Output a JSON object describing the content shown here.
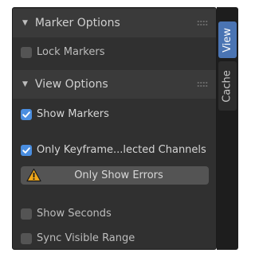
{
  "marker_options": {
    "title": "Marker Options",
    "lock_markers": "Lock Markers"
  },
  "view_options": {
    "title": "View Options",
    "show_markers": "Show Markers",
    "only_keyframes": "Only Keyframe...lected Channels",
    "only_show_errors": "Only Show Errors",
    "show_seconds": "Show Seconds",
    "sync_visible_range": "Sync Visible Range"
  },
  "tabs": {
    "view": "View",
    "cache": "Cache"
  },
  "colors": {
    "accent": "#4a8ee0",
    "tab_active": "#4a74b3",
    "warning": "#f0a81a"
  }
}
